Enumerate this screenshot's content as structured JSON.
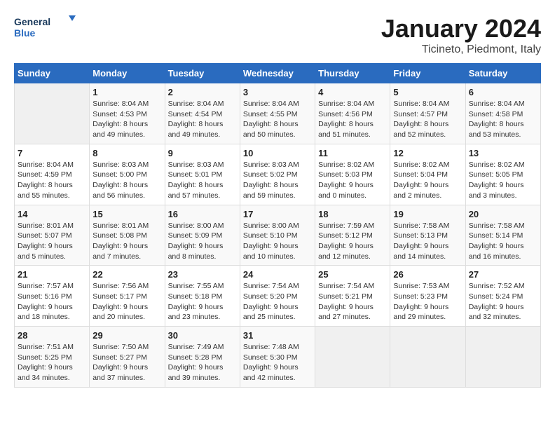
{
  "header": {
    "logo_line1": "General",
    "logo_line2": "Blue",
    "title": "January 2024",
    "subtitle": "Ticineto, Piedmont, Italy"
  },
  "calendar": {
    "days_of_week": [
      "Sunday",
      "Monday",
      "Tuesday",
      "Wednesday",
      "Thursday",
      "Friday",
      "Saturday"
    ],
    "weeks": [
      [
        {
          "day": "",
          "info": ""
        },
        {
          "day": "1",
          "info": "Sunrise: 8:04 AM\nSunset: 4:53 PM\nDaylight: 8 hours\nand 49 minutes."
        },
        {
          "day": "2",
          "info": "Sunrise: 8:04 AM\nSunset: 4:54 PM\nDaylight: 8 hours\nand 49 minutes."
        },
        {
          "day": "3",
          "info": "Sunrise: 8:04 AM\nSunset: 4:55 PM\nDaylight: 8 hours\nand 50 minutes."
        },
        {
          "day": "4",
          "info": "Sunrise: 8:04 AM\nSunset: 4:56 PM\nDaylight: 8 hours\nand 51 minutes."
        },
        {
          "day": "5",
          "info": "Sunrise: 8:04 AM\nSunset: 4:57 PM\nDaylight: 8 hours\nand 52 minutes."
        },
        {
          "day": "6",
          "info": "Sunrise: 8:04 AM\nSunset: 4:58 PM\nDaylight: 8 hours\nand 53 minutes."
        }
      ],
      [
        {
          "day": "7",
          "info": "Sunrise: 8:04 AM\nSunset: 4:59 PM\nDaylight: 8 hours\nand 55 minutes."
        },
        {
          "day": "8",
          "info": "Sunrise: 8:03 AM\nSunset: 5:00 PM\nDaylight: 8 hours\nand 56 minutes."
        },
        {
          "day": "9",
          "info": "Sunrise: 8:03 AM\nSunset: 5:01 PM\nDaylight: 8 hours\nand 57 minutes."
        },
        {
          "day": "10",
          "info": "Sunrise: 8:03 AM\nSunset: 5:02 PM\nDaylight: 8 hours\nand 59 minutes."
        },
        {
          "day": "11",
          "info": "Sunrise: 8:02 AM\nSunset: 5:03 PM\nDaylight: 9 hours\nand 0 minutes."
        },
        {
          "day": "12",
          "info": "Sunrise: 8:02 AM\nSunset: 5:04 PM\nDaylight: 9 hours\nand 2 minutes."
        },
        {
          "day": "13",
          "info": "Sunrise: 8:02 AM\nSunset: 5:05 PM\nDaylight: 9 hours\nand 3 minutes."
        }
      ],
      [
        {
          "day": "14",
          "info": "Sunrise: 8:01 AM\nSunset: 5:07 PM\nDaylight: 9 hours\nand 5 minutes."
        },
        {
          "day": "15",
          "info": "Sunrise: 8:01 AM\nSunset: 5:08 PM\nDaylight: 9 hours\nand 7 minutes."
        },
        {
          "day": "16",
          "info": "Sunrise: 8:00 AM\nSunset: 5:09 PM\nDaylight: 9 hours\nand 8 minutes."
        },
        {
          "day": "17",
          "info": "Sunrise: 8:00 AM\nSunset: 5:10 PM\nDaylight: 9 hours\nand 10 minutes."
        },
        {
          "day": "18",
          "info": "Sunrise: 7:59 AM\nSunset: 5:12 PM\nDaylight: 9 hours\nand 12 minutes."
        },
        {
          "day": "19",
          "info": "Sunrise: 7:58 AM\nSunset: 5:13 PM\nDaylight: 9 hours\nand 14 minutes."
        },
        {
          "day": "20",
          "info": "Sunrise: 7:58 AM\nSunset: 5:14 PM\nDaylight: 9 hours\nand 16 minutes."
        }
      ],
      [
        {
          "day": "21",
          "info": "Sunrise: 7:57 AM\nSunset: 5:16 PM\nDaylight: 9 hours\nand 18 minutes."
        },
        {
          "day": "22",
          "info": "Sunrise: 7:56 AM\nSunset: 5:17 PM\nDaylight: 9 hours\nand 20 minutes."
        },
        {
          "day": "23",
          "info": "Sunrise: 7:55 AM\nSunset: 5:18 PM\nDaylight: 9 hours\nand 23 minutes."
        },
        {
          "day": "24",
          "info": "Sunrise: 7:54 AM\nSunset: 5:20 PM\nDaylight: 9 hours\nand 25 minutes."
        },
        {
          "day": "25",
          "info": "Sunrise: 7:54 AM\nSunset: 5:21 PM\nDaylight: 9 hours\nand 27 minutes."
        },
        {
          "day": "26",
          "info": "Sunrise: 7:53 AM\nSunset: 5:23 PM\nDaylight: 9 hours\nand 29 minutes."
        },
        {
          "day": "27",
          "info": "Sunrise: 7:52 AM\nSunset: 5:24 PM\nDaylight: 9 hours\nand 32 minutes."
        }
      ],
      [
        {
          "day": "28",
          "info": "Sunrise: 7:51 AM\nSunset: 5:25 PM\nDaylight: 9 hours\nand 34 minutes."
        },
        {
          "day": "29",
          "info": "Sunrise: 7:50 AM\nSunset: 5:27 PM\nDaylight: 9 hours\nand 37 minutes."
        },
        {
          "day": "30",
          "info": "Sunrise: 7:49 AM\nSunset: 5:28 PM\nDaylight: 9 hours\nand 39 minutes."
        },
        {
          "day": "31",
          "info": "Sunrise: 7:48 AM\nSunset: 5:30 PM\nDaylight: 9 hours\nand 42 minutes."
        },
        {
          "day": "",
          "info": ""
        },
        {
          "day": "",
          "info": ""
        },
        {
          "day": "",
          "info": ""
        }
      ]
    ]
  }
}
